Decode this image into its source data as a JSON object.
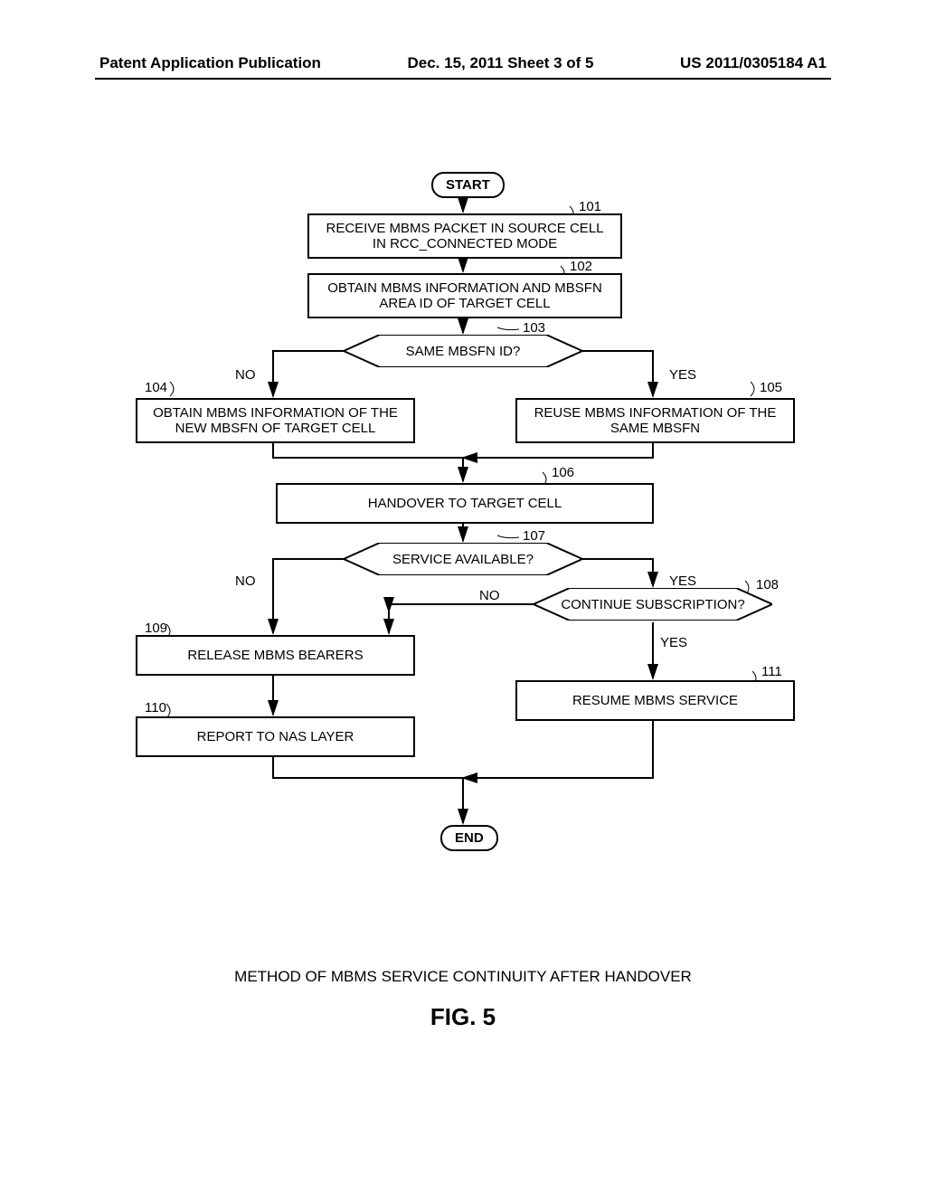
{
  "header": {
    "left": "Patent Application Publication",
    "center": "Dec. 15, 2011  Sheet 3 of 5",
    "right": "US 2011/0305184 A1"
  },
  "flow": {
    "start": "START",
    "s101": "RECEIVE MBMS PACKET IN SOURCE CELL IN RCC_CONNECTED MODE",
    "s102": "OBTAIN MBMS INFORMATION AND MBSFN AREA ID OF TARGET CELL",
    "d103": "SAME MBSFN ID?",
    "s104": "OBTAIN MBMS INFORMATION OF THE NEW MBSFN OF TARGET CELL",
    "s105": "REUSE MBMS INFORMATION OF THE SAME MBSFN",
    "s106": "HANDOVER TO TARGET CELL",
    "d107": "SERVICE AVAILABLE?",
    "d108": "CONTINUE SUBSCRIPTION?",
    "s109": "RELEASE MBMS BEARERS",
    "s110": "REPORT TO NAS LAYER",
    "s111": "RESUME MBMS SERVICE",
    "end": "END"
  },
  "refs": {
    "r101": "101",
    "r102": "102",
    "r103": "103",
    "r104": "104",
    "r105": "105",
    "r106": "106",
    "r107": "107",
    "r108": "108",
    "r109": "109",
    "r110": "110",
    "r111": "111"
  },
  "labels": {
    "yes": "YES",
    "no": "NO"
  },
  "caption": "METHOD OF MBMS SERVICE CONTINUITY AFTER HANDOVER",
  "figno": "FIG. 5"
}
